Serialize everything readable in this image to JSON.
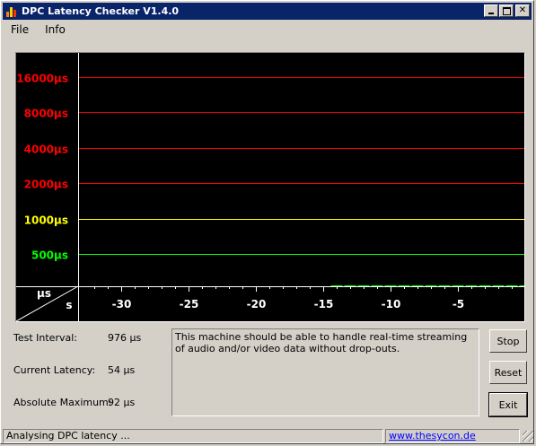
{
  "window": {
    "title": "DPC Latency Checker V1.4.0"
  },
  "menu": {
    "items": [
      {
        "label": "File"
      },
      {
        "label": "Info"
      }
    ]
  },
  "chart_data": {
    "type": "bar",
    "y_scale": "logarithmic",
    "x_unit_label": "s",
    "y_unit_label": "µs",
    "reference_lines": [
      {
        "label": "16000µs",
        "value": 16000,
        "color": "#ff0000"
      },
      {
        "label": "8000µs",
        "value": 8000,
        "color": "#ff0000"
      },
      {
        "label": "4000µs",
        "value": 4000,
        "color": "#ff0000"
      },
      {
        "label": "2000µs",
        "value": 2000,
        "color": "#ff0000"
      },
      {
        "label": "1000µs",
        "value": 1000,
        "color": "#ffff00"
      },
      {
        "label": "500µs",
        "value": 500,
        "color": "#00ff00"
      }
    ],
    "x_ticks": [
      {
        "label": "-30",
        "value": -30
      },
      {
        "label": "-25",
        "value": -25
      },
      {
        "label": "-20",
        "value": -20
      },
      {
        "label": "-15",
        "value": -15
      },
      {
        "label": "-10",
        "value": -10
      },
      {
        "label": "-5",
        "value": -5
      }
    ],
    "bar_color": "#00ff00",
    "x": [
      -14,
      -13,
      -12,
      -11,
      -10,
      -9,
      -8,
      -7,
      -6,
      -5,
      -4,
      -3,
      -2,
      -1,
      0
    ],
    "values": [
      54,
      60,
      50,
      58,
      70,
      62,
      55,
      60,
      52,
      58,
      60,
      55,
      52,
      58,
      65
    ]
  },
  "info": {
    "test_interval_label": "Test Interval:",
    "test_interval_value": "976 µs",
    "current_latency_label": "Current Latency:",
    "current_latency_value": "54 µs",
    "absolute_maximum_label": "Absolute Maximum:",
    "absolute_maximum_value": "92 µs"
  },
  "message": "This machine should be able to handle real-time streaming of audio and/or video data without drop-outs.",
  "buttons": {
    "stop": "Stop",
    "reset": "Reset",
    "exit": "Exit"
  },
  "status": {
    "text": "Analysing DPC latency ...",
    "link": "www.thesycon.de"
  }
}
